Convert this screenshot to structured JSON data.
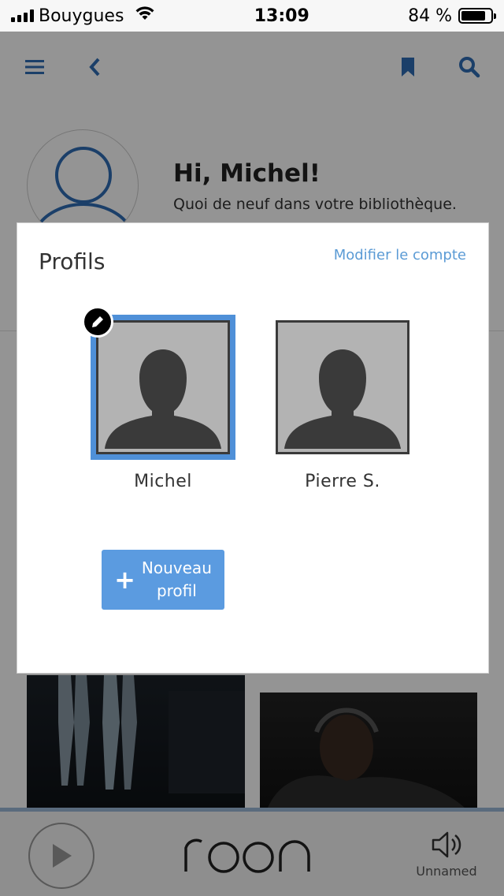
{
  "status_bar": {
    "carrier": "Bouygues",
    "time": "13:09",
    "battery": "84 %",
    "battery_level": 0.84
  },
  "header": {
    "icons": [
      "menu-icon",
      "back-icon",
      "bookmark-icon",
      "search-icon"
    ]
  },
  "greeting": {
    "title": "Hi, Michel!",
    "subtitle": "Quoi de neuf dans votre bibliothèque."
  },
  "modal": {
    "title": "Profils",
    "edit_account_link": "Modifier le compte",
    "profiles": [
      {
        "name": "Michel",
        "selected": true
      },
      {
        "name": "Pierre S.",
        "selected": false
      }
    ],
    "new_profile_label_line1": "Nouveau",
    "new_profile_label_line2": "profil"
  },
  "player": {
    "logo": "roon",
    "zone_label": "Unnamed"
  },
  "colors": {
    "accent": "#5b9be0",
    "link": "#5b9bd5",
    "selected_outline": "#4f90d8",
    "header_icon": "#2f6db5"
  }
}
